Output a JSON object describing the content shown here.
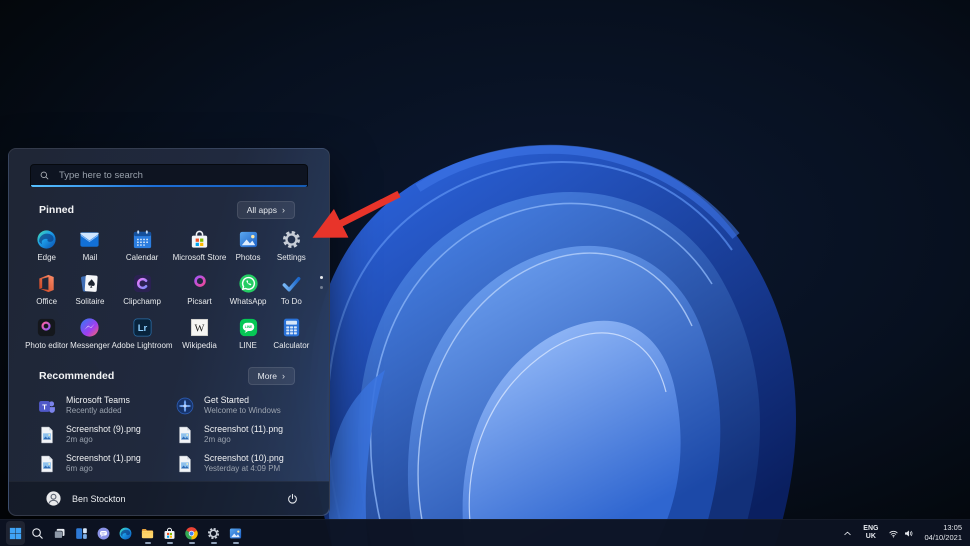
{
  "start_menu": {
    "search_placeholder": "Type here to search",
    "pinned": {
      "title": "Pinned",
      "all_apps_label": "All apps",
      "chevron": "›",
      "apps": [
        {
          "label": "Edge",
          "icon": "edge-icon"
        },
        {
          "label": "Mail",
          "icon": "mail-icon"
        },
        {
          "label": "Calendar",
          "icon": "calendar-icon"
        },
        {
          "label": "Microsoft Store",
          "icon": "microsoft-store-icon"
        },
        {
          "label": "Photos",
          "icon": "photos-icon"
        },
        {
          "label": "Settings",
          "icon": "settings-icon"
        },
        {
          "label": "Office",
          "icon": "office-icon"
        },
        {
          "label": "Solitaire",
          "icon": "solitaire-icon"
        },
        {
          "label": "Clipchamp",
          "icon": "clipchamp-icon"
        },
        {
          "label": "Picsart",
          "icon": "picsart-icon"
        },
        {
          "label": "WhatsApp",
          "icon": "whatsapp-icon"
        },
        {
          "label": "To Do",
          "icon": "todo-icon"
        },
        {
          "label": "Photo editor",
          "icon": "photo-editor-icon"
        },
        {
          "label": "Messenger",
          "icon": "messenger-icon"
        },
        {
          "label": "Adobe Lightroom",
          "icon": "lightroom-icon"
        },
        {
          "label": "Wikipedia",
          "icon": "wikipedia-icon"
        },
        {
          "label": "LINE",
          "icon": "line-icon"
        },
        {
          "label": "Calculator",
          "icon": "calculator-icon"
        }
      ]
    },
    "recommended": {
      "title": "Recommended",
      "more_label": "More",
      "chevron": "›",
      "items": [
        {
          "title": "Microsoft Teams",
          "subtitle": "Recently added",
          "icon": "teams-icon"
        },
        {
          "title": "Get Started",
          "subtitle": "Welcome to Windows",
          "icon": "get-started-icon"
        },
        {
          "title": "Screenshot (9).png",
          "subtitle": "2m ago",
          "icon": "image-file-icon"
        },
        {
          "title": "Screenshot (11).png",
          "subtitle": "2m ago",
          "icon": "image-file-icon"
        },
        {
          "title": "Screenshot (1).png",
          "subtitle": "6m ago",
          "icon": "image-file-icon"
        },
        {
          "title": "Screenshot (10).png",
          "subtitle": "Yesterday at 4:09 PM",
          "icon": "image-file-icon"
        }
      ]
    },
    "footer": {
      "user_name": "Ben Stockton"
    }
  },
  "taskbar": {
    "buttons": [
      {
        "name": "start",
        "icon": "start-icon",
        "running": false
      },
      {
        "name": "search",
        "icon": "search-icon",
        "running": false
      },
      {
        "name": "task-view",
        "icon": "task-view-icon",
        "running": false
      },
      {
        "name": "widgets",
        "icon": "widgets-icon",
        "running": false
      },
      {
        "name": "chat",
        "icon": "chat-icon",
        "running": false
      },
      {
        "name": "edge",
        "icon": "edge-icon",
        "running": false
      },
      {
        "name": "file-explorer",
        "icon": "file-explorer-icon",
        "running": true
      },
      {
        "name": "microsoft-store",
        "icon": "microsoft-store-icon",
        "running": true
      },
      {
        "name": "chrome",
        "icon": "chrome-icon",
        "running": true
      },
      {
        "name": "settings",
        "icon": "settings-icon",
        "running": true
      },
      {
        "name": "photos",
        "icon": "photos-icon",
        "running": true
      }
    ]
  },
  "system_tray": {
    "language_line1": "ENG",
    "language_line2": "UK",
    "time": "13:05",
    "date": "04/10/2021"
  },
  "annotation": {
    "arrow_color": "#e8342a",
    "target_app": "Settings"
  },
  "colors": {
    "accent": "#2f7cf6",
    "search_underline": "#1d6fd8"
  }
}
